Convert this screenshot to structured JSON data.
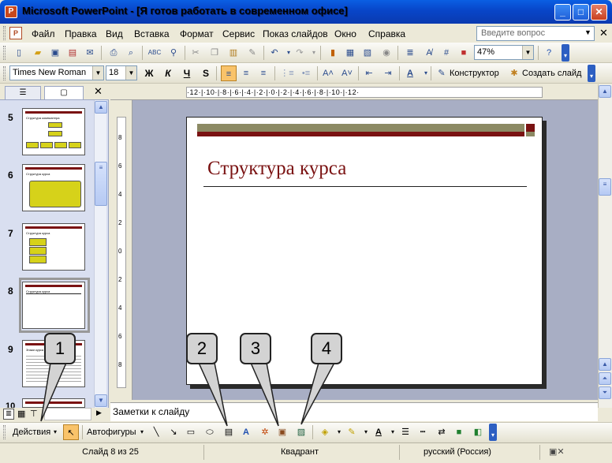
{
  "window": {
    "title": "Microsoft PowerPoint - [Я готов работать в современном офисе]",
    "app_icon": "P"
  },
  "menu": {
    "items": [
      "Файл",
      "Правка",
      "Вид",
      "Вставка",
      "Формат",
      "Сервис",
      "Показ слайдов",
      "Окно",
      "Справка"
    ],
    "help_placeholder": "Введите вопрос"
  },
  "standard_toolbar": {
    "zoom": "47%"
  },
  "formatting_toolbar": {
    "font": "Times New Roman",
    "size": "18",
    "bold": "Ж",
    "italic": "К",
    "underline": "Ч",
    "shadow": "S",
    "designer": "Конструктор",
    "new_slide": "Создать слайд"
  },
  "ruler": {
    "horizontal": "·12·|·10·|·8·|·6·|·4·|·2·|·0·|·2·|·4·|·6·|·8·|·10·|·12·",
    "vertical": [
      "8",
      "6",
      "4",
      "2",
      "0",
      "2",
      "4",
      "6",
      "8"
    ]
  },
  "thumbnails": [
    {
      "num": "5",
      "title": "Структура компьютера"
    },
    {
      "num": "6",
      "title": "Структура курса"
    },
    {
      "num": "7",
      "title": "Структура курса"
    },
    {
      "num": "8",
      "title": "Структура курса"
    },
    {
      "num": "9",
      "title": "Знаки курса"
    },
    {
      "num": "10",
      "title": ""
    }
  ],
  "slide": {
    "title": "Структура курса"
  },
  "notes": {
    "placeholder": "Заметки к слайду"
  },
  "draw_toolbar": {
    "actions": "Действия",
    "autoshapes": "Автофигуры"
  },
  "status": {
    "slide": "Слайд 8 из 25",
    "design": "Квадрант",
    "language": "русский (Россия)"
  },
  "callouts": [
    "1",
    "2",
    "3",
    "4"
  ],
  "colors": {
    "title_bar": "#0845c8",
    "slide_accent": "#7a1212",
    "slide_olive": "#8c8a64",
    "thumb_yellow": "#d6d21a"
  }
}
